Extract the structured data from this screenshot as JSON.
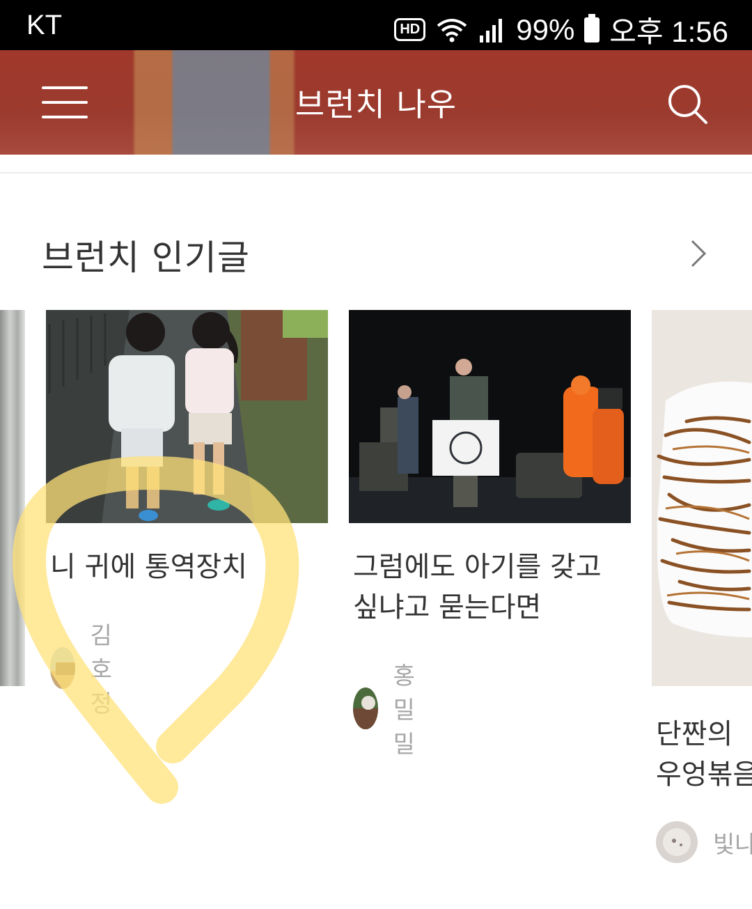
{
  "status_bar": {
    "carrier": "KT",
    "hd": "HD",
    "battery": "99%",
    "time": "오후 1:56"
  },
  "header": {
    "title": "브런치 나우",
    "menu_icon": "hamburger-menu-icon",
    "search_icon": "search-icon"
  },
  "section": {
    "title": "브런치 인기글",
    "more_icon": "chevron-right-icon"
  },
  "cards": [
    {
      "title": "니 귀에 통역장치",
      "author": "김호정"
    },
    {
      "title_line1": "그럼에도 아기를 갖고",
      "title_line2": "싶냐고 묻는다면",
      "author": "홍밀밀"
    },
    {
      "title_line1": "단짠의 ",
      "title_line2": "우엉볶음",
      "author": "빛나"
    }
  ],
  "colors": {
    "header_bg": "#a0392c",
    "highlight": "#ffe27a"
  }
}
